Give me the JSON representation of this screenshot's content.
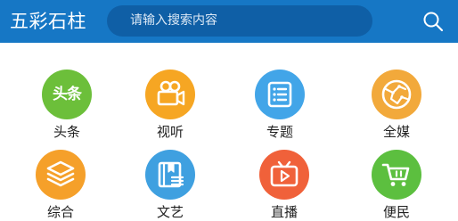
{
  "header": {
    "app_title": "五彩石柱",
    "search_placeholder": "请输入搜索内容",
    "search_icon": "search-icon"
  },
  "colors": {
    "header_bg": "#1677c5",
    "search_bg": "#0f5fa6",
    "toutiao": "#6cbf3a",
    "shiting": "#f6a623",
    "zhuanti": "#42a5e8",
    "quanmei": "#f2a93b",
    "zonghe": "#f5a02a",
    "wenyi": "#3fa0e0",
    "zhibo": "#f0613a",
    "bianmin": "#5cbf3f"
  },
  "grid": {
    "items": [
      {
        "label": "头条",
        "icon": "toutiao-icon",
        "icon_text": "头条"
      },
      {
        "label": "视听",
        "icon": "video-camera-icon"
      },
      {
        "label": "专题",
        "icon": "list-icon"
      },
      {
        "label": "全媒",
        "icon": "globe-icon"
      },
      {
        "label": "综合",
        "icon": "layers-icon"
      },
      {
        "label": "文艺",
        "icon": "book-icon"
      },
      {
        "label": "直播",
        "icon": "tv-play-icon"
      },
      {
        "label": "便民",
        "icon": "shopping-cart-icon"
      }
    ]
  }
}
